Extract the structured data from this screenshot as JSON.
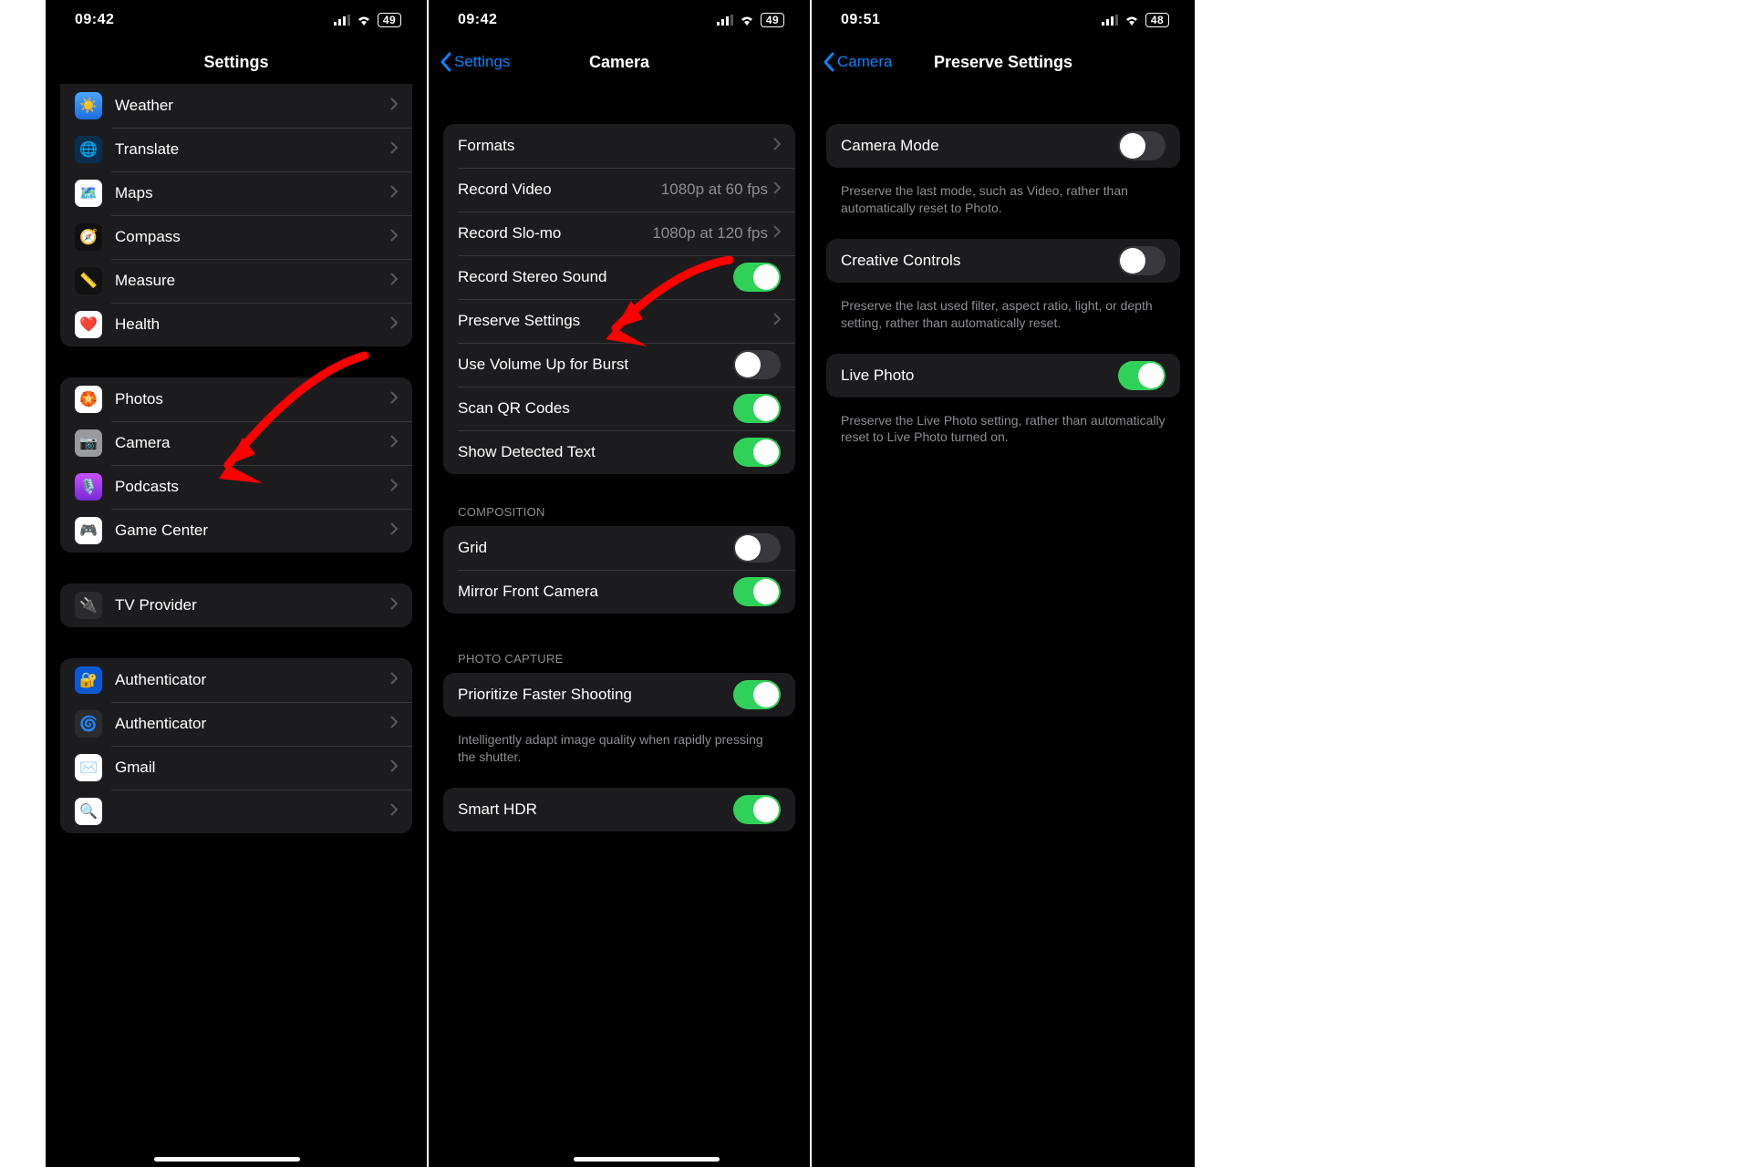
{
  "status": {
    "time_a": "09:42",
    "time_b": "09:42",
    "time_c": "09:51",
    "batt_a": "49",
    "batt_b": "49",
    "batt_c": "48"
  },
  "screen1": {
    "title": "Settings",
    "rows1": [
      {
        "label": "Weather",
        "icon": "weather"
      },
      {
        "label": "Translate",
        "icon": "translate"
      },
      {
        "label": "Maps",
        "icon": "maps"
      },
      {
        "label": "Compass",
        "icon": "compass"
      },
      {
        "label": "Measure",
        "icon": "measure"
      },
      {
        "label": "Health",
        "icon": "health"
      }
    ],
    "rows2": [
      {
        "label": "Photos",
        "icon": "photos"
      },
      {
        "label": "Camera",
        "icon": "camera"
      },
      {
        "label": "Podcasts",
        "icon": "podcasts"
      },
      {
        "label": "Game Center",
        "icon": "gamecenter"
      }
    ],
    "rows3": [
      {
        "label": "TV Provider",
        "icon": "tv"
      }
    ],
    "rows4": [
      {
        "label": "Authenticator",
        "icon": "auth1"
      },
      {
        "label": "Authenticator",
        "icon": "auth2"
      },
      {
        "label": "Gmail",
        "icon": "gmail"
      }
    ]
  },
  "screen2": {
    "back": "Settings",
    "title": "Camera",
    "g1": [
      {
        "label": "Formats",
        "type": "link"
      },
      {
        "label": "Record Video",
        "type": "link",
        "detail": "1080p at 60 fps"
      },
      {
        "label": "Record Slo-mo",
        "type": "link",
        "detail": "1080p at 120 fps"
      },
      {
        "label": "Record Stereo Sound",
        "type": "switch",
        "on": true
      },
      {
        "label": "Preserve Settings",
        "type": "link"
      },
      {
        "label": "Use Volume Up for Burst",
        "type": "switch",
        "on": false
      },
      {
        "label": "Scan QR Codes",
        "type": "switch",
        "on": true
      },
      {
        "label": "Show Detected Text",
        "type": "switch",
        "on": true
      }
    ],
    "h2": "Composition",
    "g2": [
      {
        "label": "Grid",
        "type": "switch",
        "on": false
      },
      {
        "label": "Mirror Front Camera",
        "type": "switch",
        "on": true
      }
    ],
    "h3": "Photo Capture",
    "g3": [
      {
        "label": "Prioritize Faster Shooting",
        "type": "switch",
        "on": true
      }
    ],
    "f3": "Intelligently adapt image quality when rapidly pressing the shutter.",
    "g4": [
      {
        "label": "Smart HDR",
        "type": "switch",
        "on": true
      }
    ]
  },
  "screen3": {
    "back": "Camera",
    "title": "Preserve Settings",
    "items": [
      {
        "label": "Camera Mode",
        "on": false,
        "footer": "Preserve the last mode, such as Video, rather than automatically reset to Photo."
      },
      {
        "label": "Creative Controls",
        "on": false,
        "footer": "Preserve the last used filter, aspect ratio, light, or depth setting, rather than automatically reset."
      },
      {
        "label": "Live Photo",
        "on": true,
        "footer": "Preserve the Live Photo setting, rather than automatically reset to Live Photo turned on."
      }
    ]
  },
  "colors": {
    "accent": "#0a84ff",
    "arrow": "#ff0000"
  }
}
